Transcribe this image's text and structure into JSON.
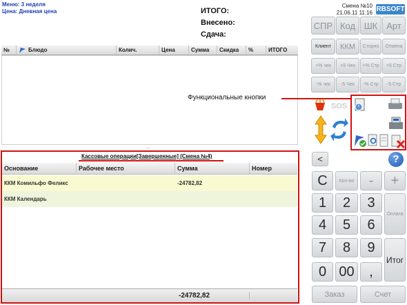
{
  "header": {
    "menu_line": "Меню: 3 неделя",
    "price_line": "Цена: Дневная цена",
    "total_label": "ИТОГО:",
    "paid_label": "Внесено:",
    "change_label": "Сдача:",
    "shift": "Смена №10",
    "datetime": "21.06.11 11:16",
    "logo": "RBSOFT"
  },
  "order_table": {
    "columns": [
      "№",
      "Блюдо",
      "Колич.",
      "Цена",
      "Сумма",
      "Скидка",
      "%",
      "ИТОГО"
    ]
  },
  "annotation": {
    "label": "Функциональные кнопки"
  },
  "top_keys": [
    "СПР",
    "Код",
    "ШК",
    "Арт"
  ],
  "row2_keys": [
    "Клиент",
    "ККМ",
    "Сторно",
    "Отмена"
  ],
  "row3_keys": [
    "+% чек",
    "+5 Чек",
    "+% Стр",
    "+5 Стр"
  ],
  "row4_keys": [
    "-% чек",
    "-5 Чек",
    "-% Стр",
    "-5 Стр"
  ],
  "kassa": {
    "title": "Кассовые операции[Завершенные] (Смена №4)",
    "columns": [
      "Основание",
      "Рабочее место",
      "Сумма",
      "Номер"
    ],
    "rows": [
      {
        "base": "ККМ Комильфо Феликс",
        "place": "",
        "sum": "-24782,82",
        "num": ""
      },
      {
        "base": "ККМ Календарь",
        "place": "",
        "sum": "",
        "num": ""
      }
    ],
    "total": "-24782,82",
    "divider": "..."
  },
  "keypad": {
    "back": "<",
    "help": "?",
    "clear": "C",
    "qty": "Кол-во",
    "minus": "-",
    "plus": "+",
    "digits": [
      "1",
      "2",
      "3",
      "4",
      "5",
      "6",
      "7",
      "8",
      "9",
      "0",
      "00",
      ","
    ],
    "pay": "Оплата",
    "total": "Итог",
    "order": "Заказ",
    "bill": "Счет"
  }
}
